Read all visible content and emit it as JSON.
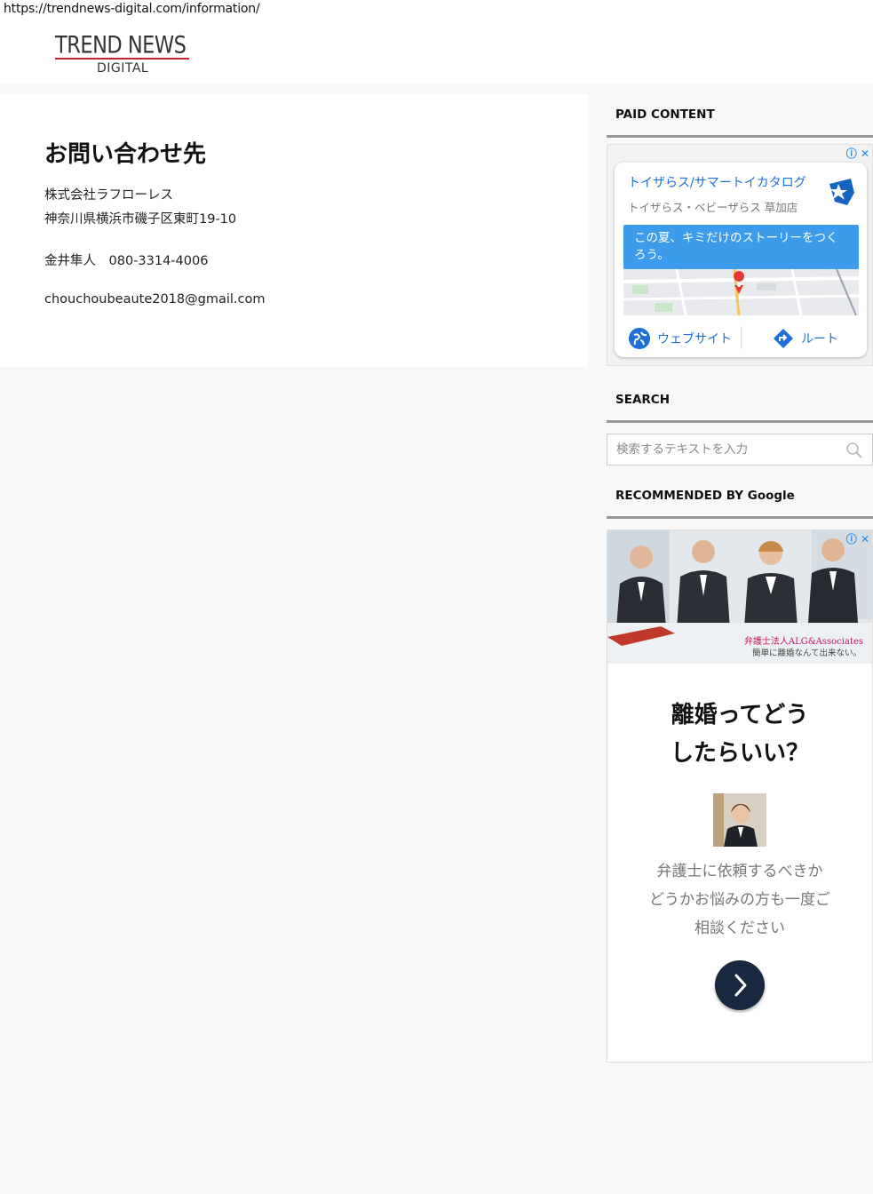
{
  "browser": {
    "url": "https://trendnews-digital.com/information/"
  },
  "site": {
    "logo_top": "TREND NEWS",
    "logo_bottom": "DIGITAL",
    "brand_color": "#c8232c"
  },
  "main": {
    "title": "お問い合わせ先",
    "company": "株式会社ラフローレス",
    "address": "神奈川県横浜市磯子区東町19-10",
    "contact_person": "金井隼人　080-3314-4006",
    "email": "chouchoubeaute2018@gmail.com"
  },
  "sidebar": {
    "paid_title": "PAID CONTENT",
    "search_title": "SEARCH",
    "search_placeholder": "検索するテキストを入力",
    "recommended_title": "RECOMMENDED BY Google"
  },
  "ad1": {
    "choices": "ⓘ ✕",
    "title": "トイザらス/サマートイカタログ",
    "subtitle": "トイザらス・ベビーザらス 草加店",
    "banner": "この夏、キミだけのストーリーをつくろう。",
    "website_button": "ウェブサイト",
    "route_button": "ルート",
    "accent_color": "#1e6fd8"
  },
  "ad2": {
    "choices": "ⓘ ✕",
    "caption1": "弁護士法人ALG&Associates",
    "caption2": "簡単に離婚なんて出来ない。",
    "headline_line1": "離婚ってどう",
    "headline_line2": "したらいい？",
    "body_line1": "弁護士に依頼するべきか",
    "body_line2": "どうかお悩みの方も一度ご",
    "body_line3": "相談ください",
    "button_color": "#17283f"
  }
}
